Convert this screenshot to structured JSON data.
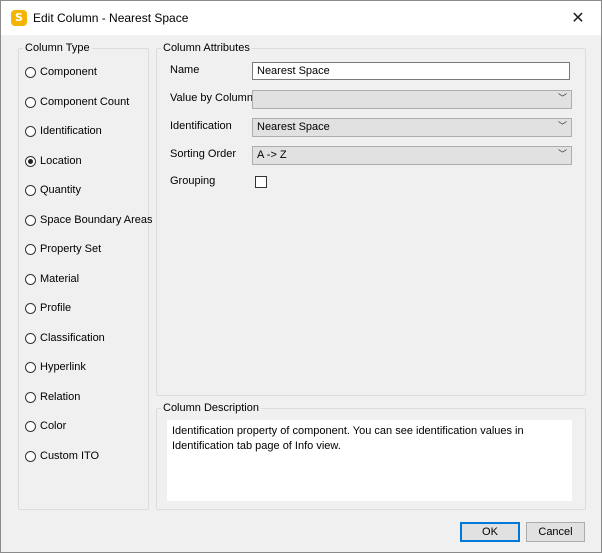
{
  "window": {
    "title": "Edit Column - Nearest Space",
    "app_icon_letter": "S",
    "close_glyph": "✕"
  },
  "column_type": {
    "legend": "Column Type",
    "items": [
      {
        "label": "Component",
        "checked": false
      },
      {
        "label": "Component Count",
        "checked": false
      },
      {
        "label": "Identification",
        "checked": false
      },
      {
        "label": "Location",
        "checked": true
      },
      {
        "label": "Quantity",
        "checked": false
      },
      {
        "label": "Space Boundary Areas",
        "checked": false
      },
      {
        "label": "Property Set",
        "checked": false
      },
      {
        "label": "Material",
        "checked": false
      },
      {
        "label": "Profile",
        "checked": false
      },
      {
        "label": "Classification",
        "checked": false
      },
      {
        "label": "Hyperlink",
        "checked": false
      },
      {
        "label": "Relation",
        "checked": false
      },
      {
        "label": "Color",
        "checked": false
      },
      {
        "label": "Custom ITO",
        "checked": false
      }
    ]
  },
  "attributes": {
    "legend": "Column Attributes",
    "name_label": "Name",
    "name_value": "Nearest Space",
    "value_by_column_label": "Value by Column",
    "value_by_column_value": "",
    "identification_label": "Identification",
    "identification_value": "Nearest Space",
    "sorting_order_label": "Sorting Order",
    "sorting_order_value": "A -> Z",
    "grouping_label": "Grouping",
    "grouping_checked": false
  },
  "description": {
    "legend": "Column Description",
    "text": "Identification property of component. You can see identification values in Identification tab page of Info view."
  },
  "buttons": {
    "ok": "OK",
    "cancel": "Cancel"
  },
  "icons": {
    "chevron": "﹀"
  },
  "colors": {
    "accent": "#0078d7",
    "app_icon": "#f5b400"
  }
}
